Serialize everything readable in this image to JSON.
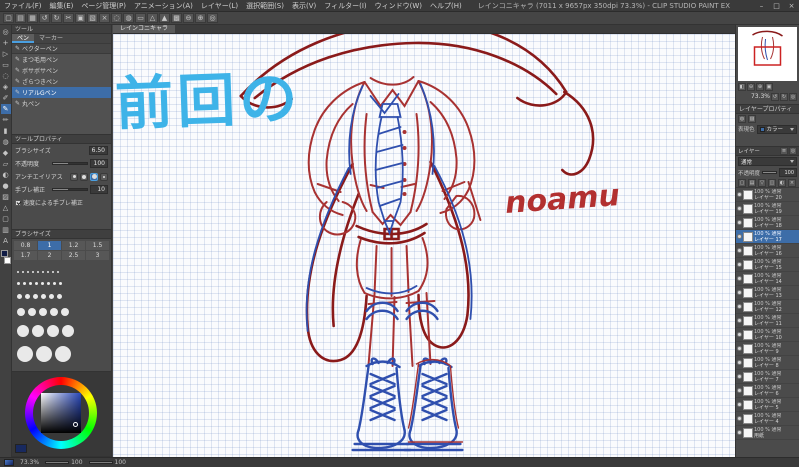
{
  "titlebar": {
    "title": "レインコニキャラ (7011 x 9657px 350dpi 73.3%) - CLIP STUDIO PAINT EX",
    "menus": [
      {
        "name": "menu-file",
        "label": "ファイル(F)"
      },
      {
        "name": "menu-edit",
        "label": "編集(E)"
      },
      {
        "name": "menu-page",
        "label": "ページ管理(P)"
      },
      {
        "name": "menu-animation",
        "label": "アニメーション(A)"
      },
      {
        "name": "menu-layer",
        "label": "レイヤー(L)"
      },
      {
        "name": "menu-selection",
        "label": "選択範囲(S)"
      },
      {
        "name": "menu-view",
        "label": "表示(V)"
      },
      {
        "name": "menu-filter",
        "label": "フィルター(I)"
      },
      {
        "name": "menu-window",
        "label": "ウィンドウ(W)"
      },
      {
        "name": "menu-help",
        "label": "ヘルプ(H)"
      }
    ],
    "window_buttons": [
      {
        "name": "minimize-button",
        "glyph": "–"
      },
      {
        "name": "maximize-button",
        "glyph": "□"
      },
      {
        "name": "close-button",
        "glyph": "×"
      }
    ]
  },
  "toolbar": {
    "icons": [
      {
        "name": "new-file-icon",
        "glyph": "▢"
      },
      {
        "name": "open-file-icon",
        "glyph": "▤"
      },
      {
        "name": "save-icon",
        "glyph": "▦"
      },
      {
        "name": "undo-icon",
        "glyph": "↺"
      },
      {
        "name": "redo-icon",
        "glyph": "↻"
      },
      {
        "name": "cut-icon",
        "glyph": "✂"
      },
      {
        "name": "copy-icon",
        "glyph": "▣"
      },
      {
        "name": "paste-icon",
        "glyph": "▧"
      },
      {
        "name": "delete-icon",
        "glyph": "×"
      },
      {
        "name": "deselect-icon",
        "glyph": "◌"
      },
      {
        "name": "invert-selection-icon",
        "glyph": "◍"
      },
      {
        "name": "selection-launcher-icon",
        "glyph": "▭"
      },
      {
        "name": "snap-ruler-icon",
        "glyph": "△"
      },
      {
        "name": "snap-special-ruler-icon",
        "glyph": "▲"
      },
      {
        "name": "snap-grid-icon",
        "glyph": "▩"
      },
      {
        "name": "zoom-out-icon",
        "glyph": "⊖"
      },
      {
        "name": "zoom-in-icon",
        "glyph": "⊕"
      },
      {
        "name": "rotate-reset-icon",
        "glyph": "◎"
      }
    ]
  },
  "toolstrip": {
    "tools": [
      {
        "name": "zoom-tool-icon",
        "glyph": "◎",
        "selected": false
      },
      {
        "name": "move-tool-icon",
        "glyph": "+",
        "selected": false
      },
      {
        "name": "operation-tool-icon",
        "glyph": "▷",
        "selected": false
      },
      {
        "name": "selection-tool-icon",
        "glyph": "▭",
        "selected": false
      },
      {
        "name": "lasso-tool-icon",
        "glyph": "◌",
        "selected": false
      },
      {
        "name": "auto-select-tool-icon",
        "glyph": "◈",
        "selected": false
      },
      {
        "name": "eyedropper-tool-icon",
        "glyph": "✐",
        "selected": false
      },
      {
        "name": "pen-tool-icon",
        "glyph": "✎",
        "selected": true
      },
      {
        "name": "pencil-tool-icon",
        "glyph": "✏",
        "selected": false
      },
      {
        "name": "brush-tool-icon",
        "glyph": "▮",
        "selected": false
      },
      {
        "name": "airbrush-tool-icon",
        "glyph": "◍",
        "selected": false
      },
      {
        "name": "decoration-tool-icon",
        "glyph": "◆",
        "selected": false
      },
      {
        "name": "eraser-tool-icon",
        "glyph": "▱",
        "selected": false
      },
      {
        "name": "blend-tool-icon",
        "glyph": "◐",
        "selected": false
      },
      {
        "name": "fill-tool-icon",
        "glyph": "●",
        "selected": false
      },
      {
        "name": "gradient-tool-icon",
        "glyph": "▨",
        "selected": false
      },
      {
        "name": "figure-tool-icon",
        "glyph": "△",
        "selected": false
      },
      {
        "name": "frame-tool-icon",
        "glyph": "▢",
        "selected": false
      },
      {
        "name": "ruler-tool-icon",
        "glyph": "▥",
        "selected": false
      },
      {
        "name": "text-tool-icon",
        "glyph": "A",
        "selected": false
      }
    ],
    "foreground_color": "#101c45",
    "background_color": "#ffffff"
  },
  "doc_tab": {
    "label": "レインコニキャラ"
  },
  "tool_panel": {
    "title": "ツール",
    "tabs": [
      {
        "name": "tab-pen",
        "label": "ペン",
        "selected": true
      },
      {
        "name": "tab-marker",
        "label": "マーカー",
        "selected": false
      }
    ],
    "group": "ベクターペン",
    "group_icon": "✎",
    "subtools": [
      {
        "label": "まつ毛用ペン",
        "glyph": "✎",
        "selected": false
      },
      {
        "label": "ボサボサペン",
        "glyph": "✎",
        "selected": false
      },
      {
        "label": "ざらつきペン",
        "glyph": "✎",
        "selected": false
      },
      {
        "label": "リアルGペン",
        "glyph": "✎",
        "selected": true
      },
      {
        "label": "丸ペン",
        "glyph": "✎",
        "selected": false
      }
    ]
  },
  "tool_property": {
    "title": "ツールプロパティ",
    "brush_size_label": "ブラシサイズ",
    "brush_size_value": "6.50",
    "opacity_label": "不透明度",
    "opacity_value": "100",
    "antialias_label": "アンチエイリアス",
    "antialias_options": [
      {
        "name": "antialias-none-button",
        "selected": false
      },
      {
        "name": "antialias-weak-button",
        "selected": false
      },
      {
        "name": "antialias-middle-button",
        "selected": true
      },
      {
        "name": "antialias-strong-button",
        "selected": false
      }
    ],
    "stabilize_label": "手ブレ補正",
    "stabilize_value": "10",
    "post_stabilize_label": "速度による手ブレ補正",
    "post_stabilize_checked": true
  },
  "brush_palette": {
    "title": "ブラシサイズ",
    "presets": [
      {
        "value": "0.8",
        "selected": false
      },
      {
        "value": "1",
        "selected": true
      },
      {
        "value": "1.2",
        "selected": false
      },
      {
        "value": "1.5",
        "selected": false
      },
      {
        "value": "1.7",
        "selected": false
      },
      {
        "value": "2",
        "selected": false
      },
      {
        "value": "2.5",
        "selected": false
      },
      {
        "value": "3",
        "selected": false
      }
    ],
    "tip_rows": {
      "a": [
        2,
        2,
        2,
        2,
        2,
        2,
        2,
        2,
        2
      ],
      "b": [
        3,
        3,
        3,
        3,
        3,
        3,
        3,
        3
      ],
      "c": [
        5,
        5,
        5,
        5,
        5,
        5
      ],
      "d": [
        8,
        8,
        8,
        8,
        8
      ],
      "e": [
        12,
        12,
        12,
        12
      ],
      "f": [
        16,
        16,
        16
      ]
    }
  },
  "color_wheel": {
    "current": "#18295f",
    "hue": "#2947b8"
  },
  "canvas": {
    "headline": "前回の",
    "headline_color": "#3eb3e8",
    "signature": "noamu",
    "signature_color": "#b23030",
    "colors": {
      "red": "#a83232",
      "dark_red": "#8a1a1a",
      "blue": "#2f4fae"
    }
  },
  "navigator": {
    "zoom": "73.3%",
    "controls_row1": [
      {
        "name": "flip-horizontal-icon",
        "glyph": "◧"
      },
      {
        "name": "zoom-out-icon",
        "glyph": "⊖"
      },
      {
        "name": "zoom-in-icon",
        "glyph": "⊕"
      },
      {
        "name": "fit-to-window-icon",
        "glyph": "▣"
      }
    ],
    "controls_row2": [
      {
        "name": "rotate-left-icon",
        "glyph": "↺"
      },
      {
        "name": "rotate-right-icon",
        "glyph": "↻"
      },
      {
        "name": "reset-view-icon",
        "glyph": "◎"
      }
    ]
  },
  "layer_property": {
    "title": "レイヤープロパティ",
    "effect_icons": [
      {
        "name": "border-effect-icon",
        "glyph": "◍"
      },
      {
        "name": "tone-effect-icon",
        "glyph": "▨"
      }
    ],
    "expression_label": "表現色",
    "expression_value": "カラー"
  },
  "layers": {
    "title": "レイヤー",
    "header_icons": [
      {
        "name": "layer-menu-icon",
        "glyph": "≡"
      },
      {
        "name": "layer-search-icon",
        "glyph": "◎"
      }
    ],
    "blend_mode": "通常",
    "opacity_label": "不透明度",
    "opacity_value": "100",
    "toolbar_icons": [
      {
        "name": "new-layer-icon",
        "glyph": "▢"
      },
      {
        "name": "new-folder-icon",
        "glyph": "▤"
      },
      {
        "name": "transfer-layer-icon",
        "glyph": "▽"
      },
      {
        "name": "merge-layer-icon",
        "glyph": "◫"
      },
      {
        "name": "layer-mask-icon",
        "glyph": "◐"
      },
      {
        "name": "delete-layer-icon",
        "glyph": "×"
      }
    ],
    "items": [
      {
        "info": "100 % 通常",
        "label": "レイヤー 20",
        "visible": true,
        "selected": false
      },
      {
        "info": "100 % 通常",
        "label": "レイヤー 19",
        "visible": true,
        "selected": false
      },
      {
        "info": "100 % 通常",
        "label": "レイヤー 18",
        "visible": true,
        "selected": false
      },
      {
        "info": "100 % 通常",
        "label": "レイヤー 17",
        "visible": true,
        "selected": true
      },
      {
        "info": "100 % 通常",
        "label": "レイヤー 16",
        "visible": true,
        "selected": false
      },
      {
        "info": "100 % 通常",
        "label": "レイヤー 15",
        "visible": true,
        "selected": false
      },
      {
        "info": "100 % 通常",
        "label": "レイヤー 14",
        "visible": true,
        "selected": false
      },
      {
        "info": "100 % 通常",
        "label": "レイヤー 13",
        "visible": true,
        "selected": false
      },
      {
        "info": "100 % 通常",
        "label": "レイヤー 12",
        "visible": true,
        "selected": false
      },
      {
        "info": "100 % 通常",
        "label": "レイヤー 11",
        "visible": true,
        "selected": false
      },
      {
        "info": "100 % 通常",
        "label": "レイヤー 10",
        "visible": true,
        "selected": false
      },
      {
        "info": "100 % 通常",
        "label": "レイヤー 9",
        "visible": true,
        "selected": false
      },
      {
        "info": "100 % 通常",
        "label": "レイヤー 8",
        "visible": true,
        "selected": false
      },
      {
        "info": "100 % 通常",
        "label": "レイヤー 7",
        "visible": true,
        "selected": false
      },
      {
        "info": "100 % 通常",
        "label": "レイヤー 6",
        "visible": true,
        "selected": false
      },
      {
        "info": "100 % 通常",
        "label": "レイヤー 5",
        "visible": true,
        "selected": false
      },
      {
        "info": "100 % 通常",
        "label": "レイヤー 4",
        "visible": true,
        "selected": false
      },
      {
        "info": "100 % 通常",
        "label": "用紙",
        "visible": true,
        "selected": false
      }
    ]
  },
  "statusbar": {
    "zoom": "73.3%",
    "sliders": [
      {
        "name": "statusbar-slider-1",
        "value": "100"
      },
      {
        "name": "statusbar-slider-2",
        "value": "100"
      }
    ]
  }
}
